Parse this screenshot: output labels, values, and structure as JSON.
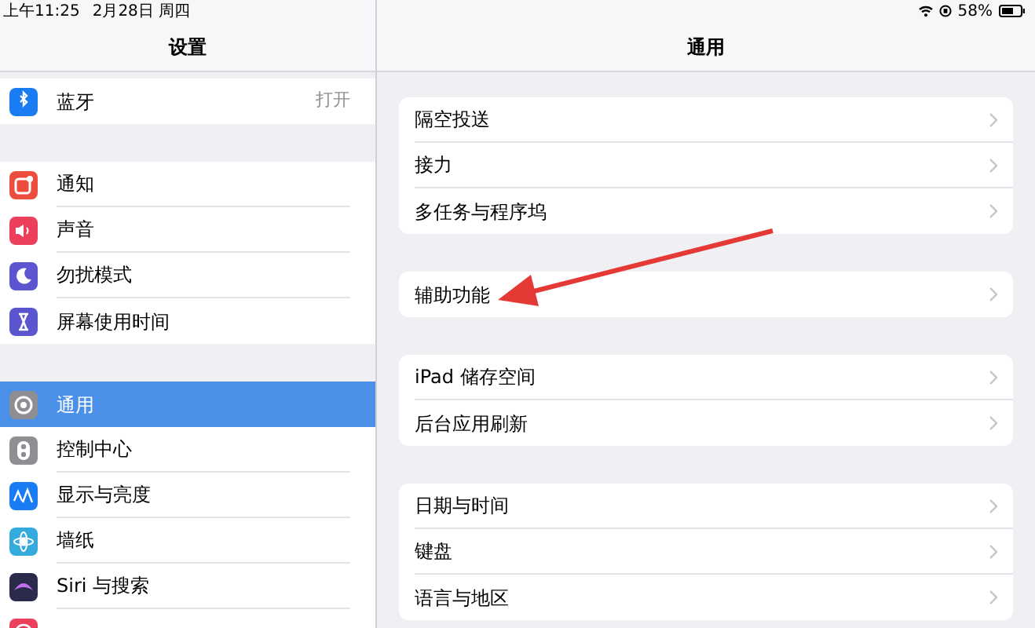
{
  "status_bar": {
    "time": "上午11:25",
    "date": "2月28日 周四",
    "battery": "58%"
  },
  "sidebar": {
    "title": "设置",
    "groups": [
      [
        {
          "label": "蓝牙",
          "value": "打开",
          "color": "#1a7cf2",
          "selected": false
        }
      ],
      [
        {
          "label": "通知",
          "color": "#ec4d3d",
          "selected": false
        },
        {
          "label": "声音",
          "color": "#ec3f5c",
          "selected": false
        },
        {
          "label": "勿扰模式",
          "color": "#5b55d0",
          "selected": false
        },
        {
          "label": "屏幕使用时间",
          "color": "#5b55d0",
          "selected": false
        }
      ],
      [
        {
          "label": "通用",
          "color": "#8e8e93",
          "selected": true
        },
        {
          "label": "控制中心",
          "color": "#8e8e93",
          "selected": false
        },
        {
          "label": "显示与亮度",
          "color": "#1a7cf2",
          "selected": false
        },
        {
          "label": "墙纸",
          "color": "#35aadc",
          "selected": false
        },
        {
          "label": "Siri 与搜索",
          "color": "#2a2a4a",
          "selected": false
        },
        {
          "color": "#ec3f5c",
          "selected": false
        }
      ]
    ]
  },
  "detail": {
    "title": "通用",
    "groups": [
      [
        "隔空投送",
        "接力",
        "多任务与程序坞"
      ],
      [
        "辅助功能"
      ],
      [
        "iPad 储存空间",
        "后台应用刷新"
      ],
      [
        "日期与时间",
        "键盘",
        "语言与地区"
      ]
    ]
  }
}
